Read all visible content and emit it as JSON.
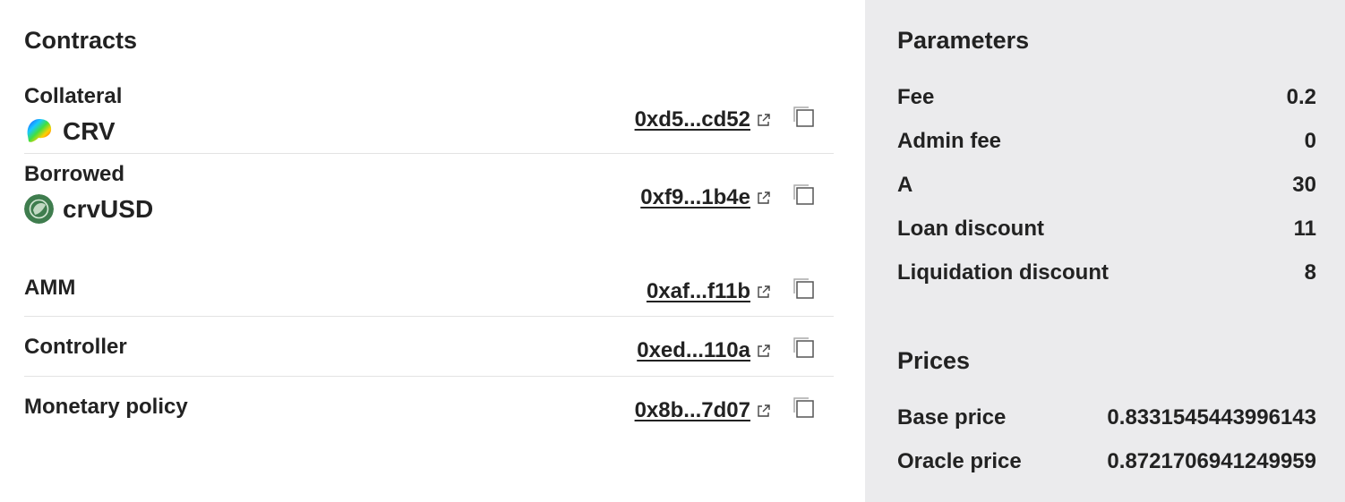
{
  "contracts": {
    "title": "Contracts",
    "collateral": {
      "label": "Collateral",
      "token_symbol": "CRV",
      "token_icon": "crv-logo-icon",
      "address": "0xd5...cd52"
    },
    "borrowed": {
      "label": "Borrowed",
      "token_symbol": "crvUSD",
      "token_icon": "crvusd-logo-icon",
      "address": "0xf9...1b4e"
    },
    "amm": {
      "label": "AMM",
      "address": "0xaf...f11b"
    },
    "controller": {
      "label": "Controller",
      "address": "0xed...110a"
    },
    "monetary_policy": {
      "label": "Monetary policy",
      "address": "0x8b...7d07"
    }
  },
  "parameters": {
    "title": "Parameters",
    "items": [
      {
        "label": "Fee",
        "value": "0.2"
      },
      {
        "label": "Admin fee",
        "value": "0"
      },
      {
        "label": "A",
        "value": "30"
      },
      {
        "label": "Loan discount",
        "value": "11"
      },
      {
        "label": "Liquidation discount",
        "value": "8"
      }
    ]
  },
  "prices": {
    "title": "Prices",
    "items": [
      {
        "label": "Base price",
        "value": "0.8331545443996143"
      },
      {
        "label": "Oracle price",
        "value": "0.8721706941249959"
      }
    ]
  },
  "icons": {
    "external_link": "external-link-icon",
    "copy": "copy-icon"
  },
  "colors": {
    "text": "#222222",
    "sidebar_bg": "#ebebed",
    "divider": "#e3e3e3",
    "crvusd_green": "#3f7d4e"
  }
}
